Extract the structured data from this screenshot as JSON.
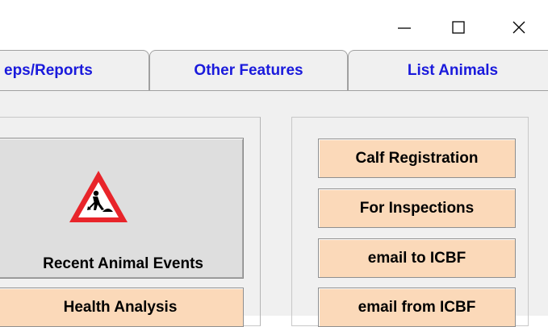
{
  "window": {
    "minimize_icon": "minimize-icon",
    "maximize_icon": "maximize-icon",
    "close_icon": "close-icon"
  },
  "tabs": [
    {
      "label": "eps/Reports"
    },
    {
      "label": "Other Features"
    },
    {
      "label": "List Animals"
    }
  ],
  "left_panel": {
    "recent_events_label": "Recent Animal Events",
    "recent_events_icon": "roadworks-warning-icon",
    "health_analysis_label": "Health Analysis"
  },
  "right_panel": {
    "buttons": [
      {
        "label": "Calf Registration"
      },
      {
        "label": "For Inspections"
      },
      {
        "label": "email to ICBF"
      },
      {
        "label": "email from ICBF"
      }
    ]
  },
  "colors": {
    "tab_text": "#1a1adc",
    "button_peach": "#fbd9b9",
    "panel_bg": "#f0f0f0",
    "warning_red": "#e8242a"
  }
}
